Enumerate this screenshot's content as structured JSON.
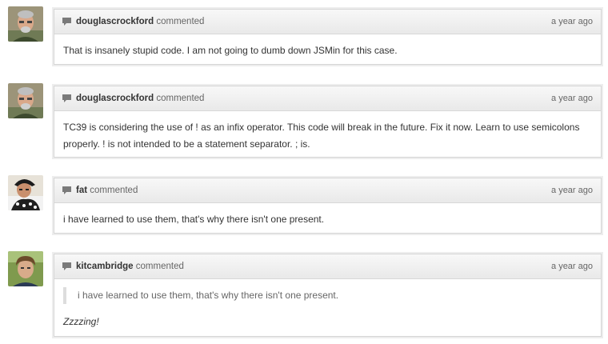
{
  "comments": [
    {
      "author": "douglascrockford",
      "action": "commented",
      "time": "a year ago",
      "avatar": "douglascrockford-avatar",
      "body": "That is insanely stupid code. I am not going to dumb down JSMin for this case."
    },
    {
      "author": "douglascrockford",
      "action": "commented",
      "time": "a year ago",
      "avatar": "douglascrockford-avatar",
      "body": "TC39 is considering the use of ! as an infix operator. This code will break in the future. Fix it now. Learn to use semicolons properly. ! is not intended to be a statement separator. ; is."
    },
    {
      "author": "fat",
      "action": "commented",
      "time": "a year ago",
      "avatar": "fat-avatar",
      "body": "i have learned to use them, that's why there isn't one present."
    },
    {
      "author": "kitcambridge",
      "action": "commented",
      "time": "a year ago",
      "avatar": "kitcambridge-avatar",
      "quote": "i have learned to use them, that's why there isn't one present.",
      "body": "Zzzzing!"
    }
  ],
  "icons": {
    "comment": "speech-bubble-icon"
  },
  "colors": {
    "header_bg": "#eeeeee",
    "border": "#d6d6d6",
    "text": "#333333",
    "muted": "#666666"
  }
}
